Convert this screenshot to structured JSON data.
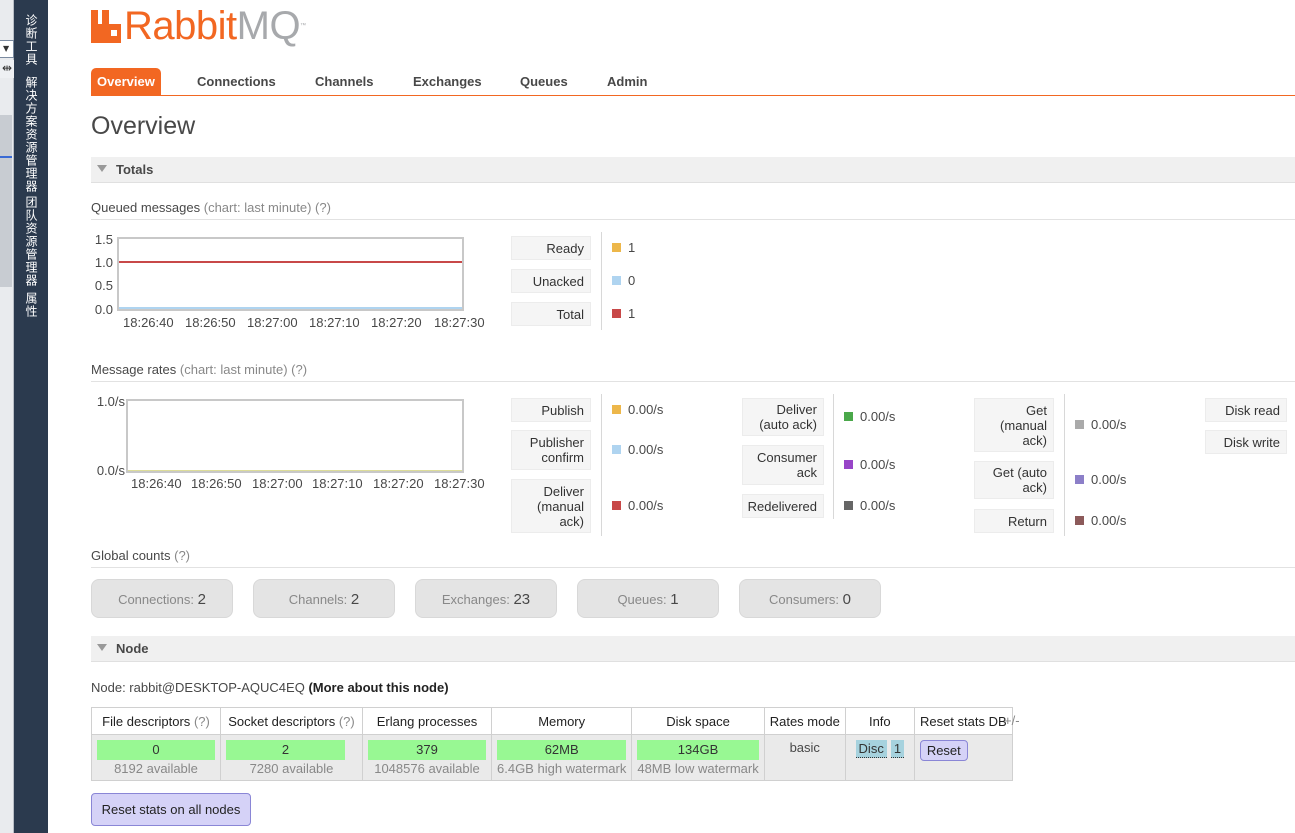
{
  "ide": {
    "vertical_tabs": [
      "诊断工具",
      "解决方案资源管理器",
      "团队资源管理器",
      "属性"
    ]
  },
  "logo": {
    "rabbit": "Rabbit",
    "mq": "MQ",
    "tm": "™",
    "brand_color": "#f26722"
  },
  "nav": {
    "tabs": [
      "Overview",
      "Connections",
      "Channels",
      "Exchanges",
      "Queues",
      "Admin"
    ],
    "active": "Overview"
  },
  "page_title": "Overview",
  "totals": {
    "title": "Totals",
    "queued": {
      "heading": "Queued messages",
      "hint": "(chart: last minute) (?)",
      "y_ticks": [
        "1.5",
        "1.0",
        "0.5",
        "0.0"
      ],
      "x_ticks": [
        "18:26:40",
        "18:26:50",
        "18:27:00",
        "18:27:10",
        "18:27:20",
        "18:27:30"
      ],
      "legend": [
        {
          "label": "Ready",
          "value": "1",
          "color": "#edb74a"
        },
        {
          "label": "Unacked",
          "value": "0",
          "color": "#afd4f0"
        },
        {
          "label": "Total",
          "value": "1",
          "color": "#c84848"
        }
      ]
    },
    "rates": {
      "heading": "Message rates",
      "hint": "(chart: last minute) (?)",
      "y_ticks": [
        "1.0/s",
        "0.0/s"
      ],
      "x_ticks": [
        "18:26:40",
        "18:26:50",
        "18:27:00",
        "18:27:10",
        "18:27:20",
        "18:27:30"
      ],
      "col1": [
        {
          "label": "Publish",
          "value": "0.00/s",
          "color": "#edb74a"
        },
        {
          "label": "Publisher confirm",
          "value": "0.00/s",
          "color": "#afd4f0"
        },
        {
          "label": "Deliver (manual ack)",
          "value": "0.00/s",
          "color": "#c84848"
        }
      ],
      "col2": [
        {
          "label": "Deliver (auto ack)",
          "value": "0.00/s",
          "color": "#4aa84a"
        },
        {
          "label": "Consumer ack",
          "value": "0.00/s",
          "color": "#9845c8"
        },
        {
          "label": "Redelivered",
          "value": "0.00/s",
          "color": "#666666"
        }
      ],
      "col3": [
        {
          "label": "Get (manual ack)",
          "value": "0.00/s",
          "color": "#aaaaaa"
        },
        {
          "label": "Get (auto ack)",
          "value": "0.00/s",
          "color": "#8c7fc8"
        },
        {
          "label": "Return",
          "value": "0.00/s",
          "color": "#8c5a5a"
        }
      ],
      "col4": [
        {
          "label": "Disk read"
        },
        {
          "label": "Disk write"
        }
      ]
    },
    "global_counts": {
      "heading": "Global counts",
      "hint": "(?)",
      "items": [
        {
          "label": "Connections:",
          "value": "2"
        },
        {
          "label": "Channels:",
          "value": "2"
        },
        {
          "label": "Exchanges:",
          "value": "23"
        },
        {
          "label": "Queues:",
          "value": "1"
        },
        {
          "label": "Consumers:",
          "value": "0"
        }
      ]
    }
  },
  "node": {
    "title": "Node",
    "node_prefix": "Node: rabbit@DESKTOP-AQUC4EQ",
    "more_link": "(More about this node)",
    "headers": {
      "fd": "File descriptors",
      "fd_q": "(?)",
      "sd": "Socket descriptors",
      "sd_q": "(?)",
      "erl": "Erlang processes",
      "mem": "Memory",
      "disk": "Disk space",
      "rates": "Rates mode",
      "info": "Info",
      "reset": "Reset stats DB"
    },
    "row": {
      "fd_value": "0",
      "fd_sub": "8192 available",
      "sd_value": "2",
      "sd_sub": "7280 available",
      "erl_value": "379",
      "erl_sub": "1048576 available",
      "mem_value": "62MB",
      "mem_sub": "6.4GB high watermark",
      "disk_value": "134GB",
      "disk_sub": "48MB low watermark",
      "rates_mode": "basic",
      "info_tags": [
        "Disc",
        "1"
      ],
      "reset_label": "Reset"
    },
    "plus_minus": "+/-"
  },
  "reset_all_label": "Reset stats on all nodes"
}
